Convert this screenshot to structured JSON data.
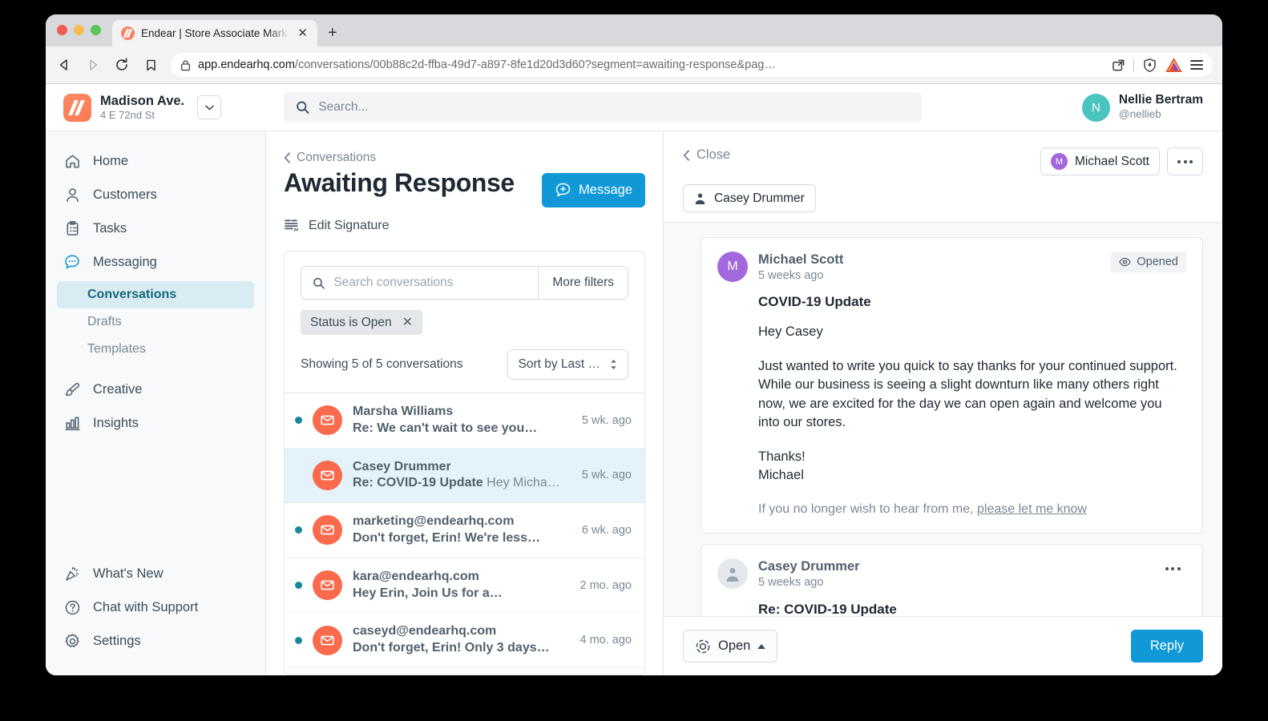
{
  "browser": {
    "tab_title": "Endear | Store Associate Marketing",
    "tab_close": "✕",
    "new_tab": "+",
    "url_host": "app.endearhq.com",
    "url_path": "/conversations/00b88c2d-ffba-49d7-a897-8fe1d20d3d60?segment=awaiting-response&pag…"
  },
  "header": {
    "store_name": "Madison Ave.",
    "store_address": "4 E 72nd St",
    "search_placeholder": "Search...",
    "user_initial": "N",
    "user_name": "Nellie Bertram",
    "user_handle": "@nellieb"
  },
  "sidebar": {
    "items": [
      {
        "label": "Home",
        "icon": "home-icon"
      },
      {
        "label": "Customers",
        "icon": "person-icon"
      },
      {
        "label": "Tasks",
        "icon": "clipboard-icon"
      },
      {
        "label": "Messaging",
        "icon": "chat-icon"
      }
    ],
    "sub_items": [
      {
        "label": "Conversations",
        "active": true
      },
      {
        "label": "Drafts",
        "active": false
      },
      {
        "label": "Templates",
        "active": false
      }
    ],
    "items2": [
      {
        "label": "Creative",
        "icon": "brush-icon"
      },
      {
        "label": "Insights",
        "icon": "bar-chart-icon"
      }
    ],
    "bottom_items": [
      {
        "label": "What's New",
        "icon": "party-popper-icon"
      },
      {
        "label": "Chat with Support",
        "icon": "question-circle-icon"
      },
      {
        "label": "Settings",
        "icon": "gear-icon"
      }
    ]
  },
  "list": {
    "breadcrumb": "Conversations",
    "title": "Awaiting Response",
    "message_button": "Message",
    "edit_signature": "Edit Signature",
    "search_placeholder": "Search conversations",
    "more_filters": "More filters",
    "filter_chip": "Status is Open",
    "filter_chip_remove": "✕",
    "count_text": "Showing 5 of 5 conversations",
    "sort_label": "Sort by Last …",
    "conversations": [
      {
        "from": "Marsha Williams",
        "preview": "Re: We can't wait to see you…",
        "snippet": "",
        "time": "5 wk. ago",
        "unread": true,
        "selected": false
      },
      {
        "from": "Casey Drummer",
        "preview": "Re: COVID-19 Update",
        "snippet": " Hey Micha…",
        "time": "5 wk. ago",
        "unread": false,
        "selected": true
      },
      {
        "from": "marketing@endearhq.com",
        "preview": "Don't forget, Erin! We're less…",
        "snippet": "",
        "time": "6 wk. ago",
        "unread": true,
        "selected": false
      },
      {
        "from": "kara@endearhq.com",
        "preview": "Hey Erin, Join Us for a…",
        "snippet": "",
        "time": "2 mo. ago",
        "unread": true,
        "selected": false
      },
      {
        "from": "caseyd@endearhq.com",
        "preview": "Don't forget, Erin! Only 3 days…",
        "snippet": "",
        "time": "4 mo. ago",
        "unread": true,
        "selected": false
      }
    ]
  },
  "thread": {
    "close_label": "Close",
    "assignee_initial": "M",
    "assignee_name": "Michael Scott",
    "recipient_name": "Casey Drummer",
    "messages": [
      {
        "initial": "M",
        "author": "Michael Scott",
        "time": "5 weeks ago",
        "badge": "Opened",
        "subject": "COVID-19 Update",
        "greeting": "Hey Casey",
        "paragraph": "Just wanted to write you quick to say thanks for your continued support. While our business is seeing a slight downturn like many others right now, we are excited for the day we can open again and welcome you into our stores.",
        "signoff": "Thanks!",
        "signature": "Michael",
        "footer_text": "If you no longer wish to hear from me, ",
        "footer_link": "please let me know"
      },
      {
        "author": "Casey Drummer",
        "time": "5 weeks ago",
        "subject": "Re: COVID-19 Update"
      }
    ],
    "status_label": "Open",
    "reply_label": "Reply"
  },
  "colors": {
    "accent_blue": "#1099d6",
    "brand_orange": "#fa8363",
    "teal": "#4ac4bf",
    "purple": "#a368dd",
    "selected_row": "#e4f2f9",
    "active_nav": "#d9ecf2"
  }
}
